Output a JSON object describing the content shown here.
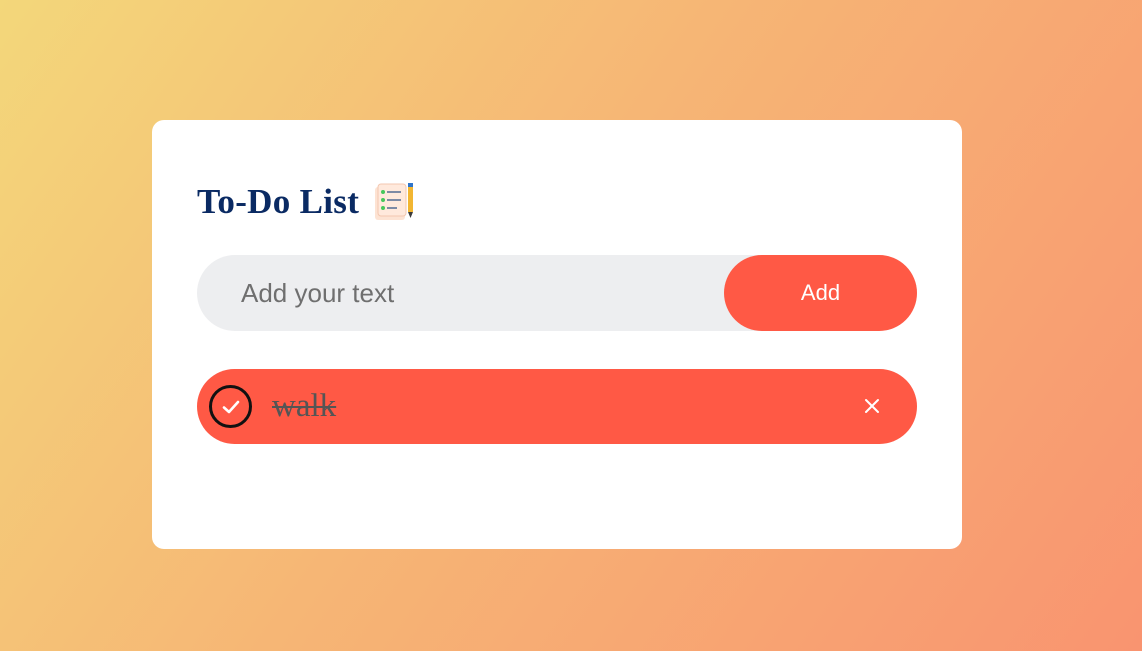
{
  "app": {
    "title": "To-Do List",
    "title_icon": "notepad-pencil-icon"
  },
  "add_form": {
    "input_value": "",
    "input_placeholder": "Add your text",
    "add_label": "Add"
  },
  "tasks": [
    {
      "text": "walk",
      "completed": true,
      "check_icon": "check-icon",
      "delete_icon": "close-icon"
    }
  ],
  "colors": {
    "accent": "#ff5945",
    "title": "#0a2a63",
    "input_background": "#edeef0",
    "background_gradient_start": "#f3d77a",
    "background_gradient_end": "#f99470"
  }
}
